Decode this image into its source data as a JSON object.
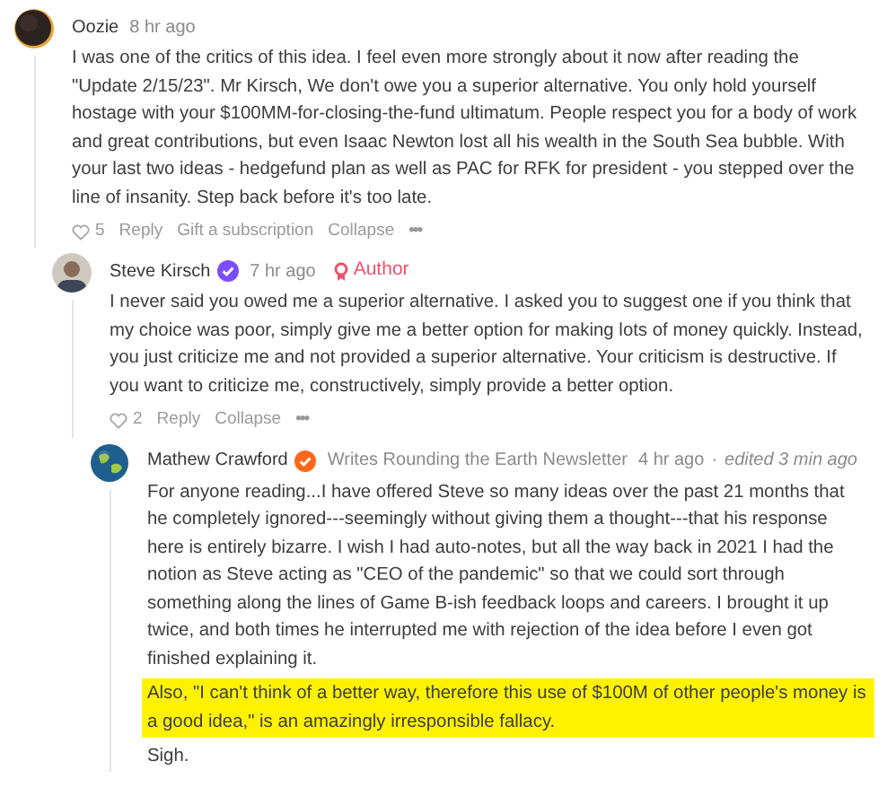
{
  "comments": [
    {
      "author": "Oozie",
      "time": "8 hr ago",
      "paragraphs": [
        {
          "text": "I was one of the critics of this idea. I feel even more strongly about it now after reading the \"Update 2/15/23\". Mr Kirsch, We don't owe you a superior alternative. You only hold yourself hostage with your $100MM-for-closing-the-fund ultimatum. People respect you for a body of work and great contributions, but even Isaac Newton lost all his wealth in the South Sea bubble. With your last two ideas - hedgefund plan as well as PAC for RFK for president - you stepped over the line of insanity. Step back before it's too late.",
          "highlighted": false
        }
      ],
      "likes": "5",
      "actions": [
        "Reply",
        "Gift a subscription",
        "Collapse"
      ],
      "more": "•••",
      "children": [
        {
          "author": "Steve Kirsch",
          "badge": {
            "color": "#7c4dff"
          },
          "time": "7 hr ago",
          "tag": "Author",
          "paragraphs": [
            {
              "text": "I never said you owed me a superior alternative. I asked you to suggest one if you think that my choice was poor, simply give me a better option for making lots of money quickly. Instead, you just criticize me and not provided a superior alternative. Your criticism is destructive. If you want to criticize me, constructively, simply provide a better option.",
              "highlighted": false
            }
          ],
          "likes": "2",
          "actions": [
            "Reply",
            "Collapse"
          ],
          "more": "•••",
          "children": [
            {
              "author": "Mathew Crawford",
              "badge": {
                "color": "#ff6719"
              },
              "byline": "Writes Rounding the Earth Newsletter",
              "time": "4 hr ago",
              "separator": "·",
              "edited": "edited 3 min ago",
              "paragraphs": [
                {
                  "text": "For anyone reading...I have offered Steve so many ideas over the past 21 months that he completely ignored---seemingly without giving them a thought---that his response here is entirely bizarre. I wish I had auto-notes, but all the way back in 2021 I had the notion as Steve acting as \"CEO of the pandemic\" so that we could sort through something along the lines of Game B-ish feedback loops and careers. I brought it up twice, and both times he interrupted me with rejection of the idea before I even got finished explaining it.",
                  "highlighted": false
                },
                {
                  "text": "Also, \"I can't think of a better way, therefore this use of $100M of other people's money is a good idea,\" is an amazingly irresponsible fallacy.",
                  "highlighted": true
                },
                {
                  "text": "Sigh.",
                  "highlighted": false
                }
              ]
            }
          ]
        }
      ]
    }
  ]
}
